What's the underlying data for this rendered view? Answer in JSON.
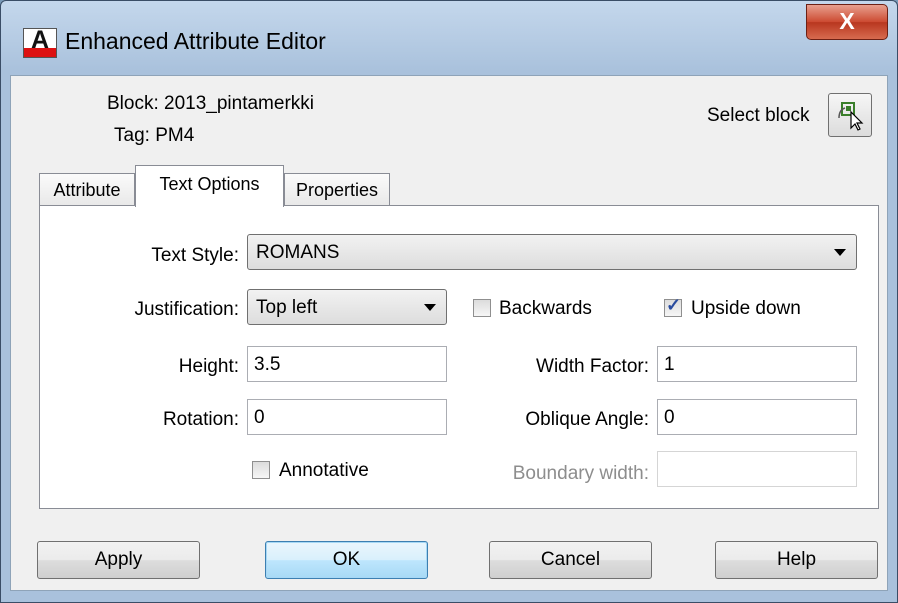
{
  "window": {
    "title": "Enhanced Attribute Editor",
    "close_symbol": "X",
    "app_icon_letter": "A"
  },
  "info": {
    "block_label": "Block: 2013_pintamerkki",
    "tag_label": "Tag: PM4",
    "select_block_label": "Select block",
    "select_block_icon": "pick-object-icon"
  },
  "tabs": [
    {
      "label": "Attribute",
      "active": false
    },
    {
      "label": "Text Options",
      "active": true
    },
    {
      "label": "Properties",
      "active": false
    }
  ],
  "text_options": {
    "text_style_label": "Text Style:",
    "text_style_value": "ROMANS",
    "justification_label": "Justification:",
    "justification_value": "Top left",
    "backwards_label": "Backwards",
    "backwards_checked": false,
    "upside_down_label": "Upside down",
    "upside_down_checked": true,
    "height_label": "Height:",
    "height_value": "3.5",
    "width_factor_label": "Width Factor:",
    "width_factor_value": "1",
    "rotation_label": "Rotation:",
    "rotation_value": "0",
    "oblique_angle_label": "Oblique Angle:",
    "oblique_angle_value": "0",
    "annotative_label": "Annotative",
    "annotative_checked": false,
    "boundary_width_label": "Boundary width:",
    "boundary_width_value": ""
  },
  "buttons": {
    "apply": "Apply",
    "ok": "OK",
    "cancel": "Cancel",
    "help": "Help"
  },
  "colors": {
    "title_bar": "#b5cbe3",
    "close_button": "#cc4a31",
    "checkbox_mark": "#2a4c9e"
  }
}
